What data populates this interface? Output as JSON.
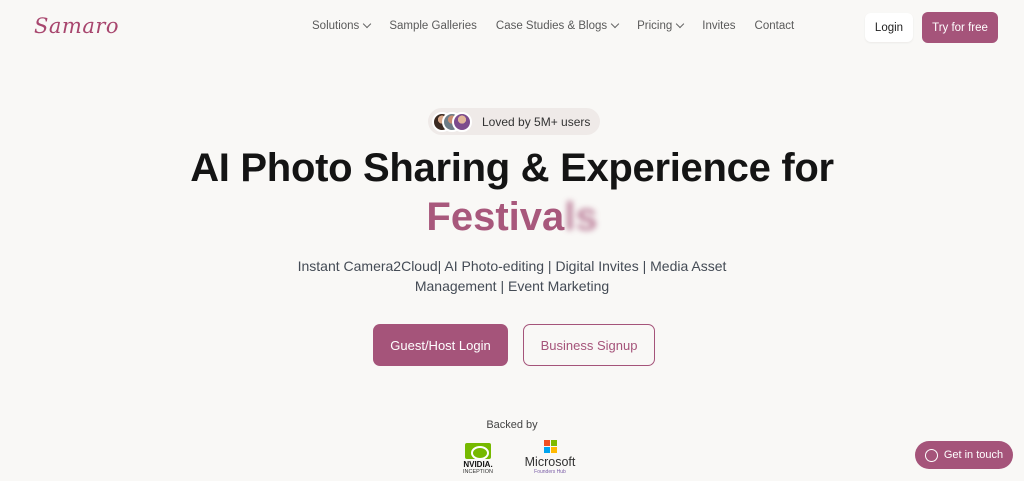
{
  "brand": {
    "logo_text": "Samaro",
    "accent_color": "#a5547a"
  },
  "nav": {
    "items": [
      {
        "label": "Solutions",
        "has_dropdown": true
      },
      {
        "label": "Sample Galleries",
        "has_dropdown": false
      },
      {
        "label": "Case Studies & Blogs",
        "has_dropdown": true
      },
      {
        "label": "Pricing",
        "has_dropdown": true
      },
      {
        "label": "Invites",
        "has_dropdown": false
      },
      {
        "label": "Contact",
        "has_dropdown": false
      }
    ],
    "login_label": "Login",
    "try_label": "Try for free"
  },
  "hero": {
    "social_proof": "Loved by 5M+ users",
    "headline": "AI Photo Sharing & Experience for",
    "rotating_word_visible": "Festiva",
    "rotating_word_fading": "ls",
    "subtitle": "Instant Camera2Cloud| AI Photo-editing | Digital Invites | Media Asset Management | Event Marketing",
    "primary_cta": "Guest/Host Login",
    "secondary_cta": "Business Signup"
  },
  "backers": {
    "heading": "Backed by",
    "nvidia_name": "NVIDIA.",
    "nvidia_sub": "INCEPTION",
    "microsoft_name": "Microsoft",
    "microsoft_sub": "Founders Hub"
  },
  "chat": {
    "label": "Get in touch",
    "icon": "whatsapp-icon"
  }
}
